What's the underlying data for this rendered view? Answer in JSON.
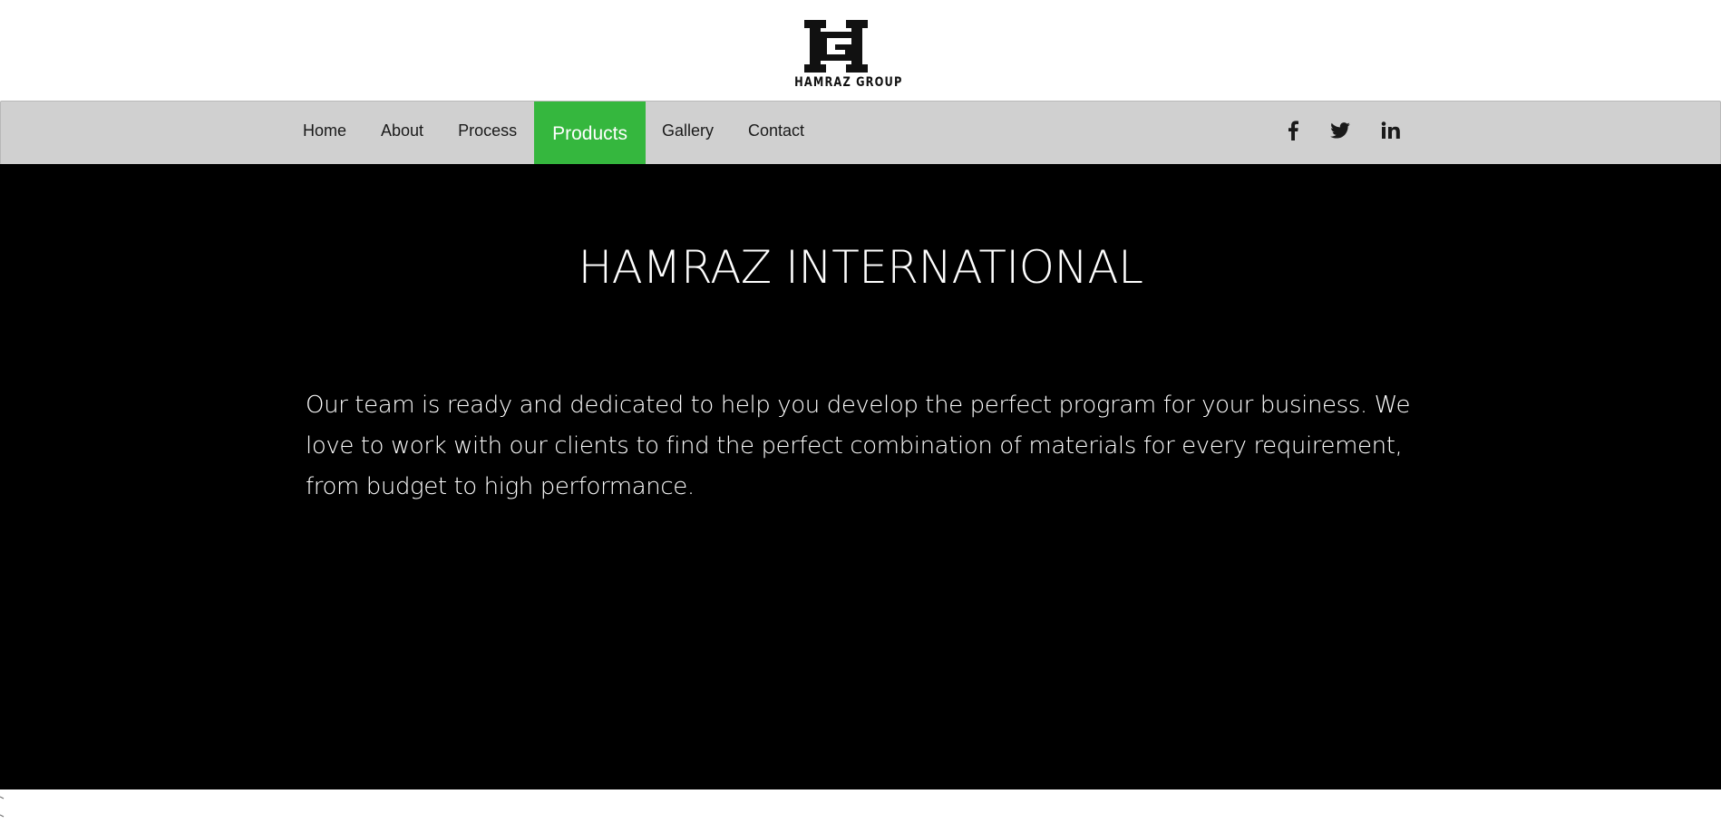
{
  "brand": {
    "logo_text": "HAMRAZ GROUP"
  },
  "nav": {
    "items": [
      {
        "label": "Home",
        "active": false
      },
      {
        "label": "About",
        "active": false
      },
      {
        "label": "Process",
        "active": false
      },
      {
        "label": "Products",
        "active": true
      },
      {
        "label": "Gallery",
        "active": false
      },
      {
        "label": "Contact",
        "active": false
      }
    ],
    "social": [
      {
        "icon": "facebook-icon",
        "glyph": "f"
      },
      {
        "icon": "twitter-icon",
        "glyph": "twitter"
      },
      {
        "icon": "linkedin-icon",
        "glyph": "in"
      }
    ]
  },
  "hero": {
    "title": "HAMRAZ INTERNATIONAL",
    "body": "Our team is ready and dedicated to help you develop the perfect program for your business. We love to work with our clients to find the perfect combination of materials for every requirement, from budget to high performance."
  },
  "colors": {
    "accent": "#35b73e",
    "navbar": "#d0d0d0",
    "hero_bg": "#000000"
  }
}
